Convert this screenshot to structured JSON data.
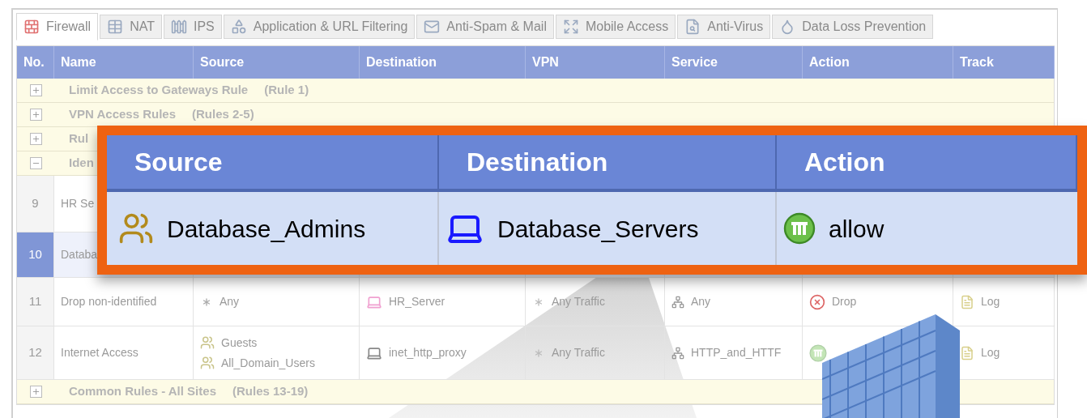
{
  "tabs": [
    {
      "label": "Firewall",
      "selected": true
    },
    {
      "label": "NAT",
      "selected": false
    },
    {
      "label": "IPS",
      "selected": false
    },
    {
      "label": "Application & URL Filtering",
      "selected": false
    },
    {
      "label": "Anti-Spam & Mail",
      "selected": false
    },
    {
      "label": "Mobile Access",
      "selected": false
    },
    {
      "label": "Anti-Virus",
      "selected": false
    },
    {
      "label": "Data Loss Prevention",
      "selected": false
    }
  ],
  "table": {
    "columns": [
      "No.",
      "Name",
      "Source",
      "Destination",
      "VPN",
      "Service",
      "Action",
      "Track"
    ],
    "rows": [
      {
        "kind": "group",
        "expanded": false,
        "title": "Limit Access to Gateways Rule",
        "range": "(Rule 1)"
      },
      {
        "kind": "group",
        "expanded": false,
        "title": "VPN Access Rules",
        "range": "(Rules 2-5)"
      },
      {
        "kind": "group",
        "expanded": false,
        "title": "Rul"
      },
      {
        "kind": "group",
        "expanded": true,
        "title": "Iden"
      },
      {
        "kind": "rule",
        "number": "9",
        "selected": false,
        "name": "HR Se"
      },
      {
        "kind": "rule",
        "number": "10",
        "selected": true,
        "name": "Databa"
      },
      {
        "kind": "rule",
        "number": "11",
        "selected": false,
        "name": "Drop non-identified",
        "source": [
          "Any"
        ],
        "destination": "HR_Server",
        "vpn": "Any Traffic",
        "service": "Any",
        "action": "Drop",
        "action_allowed": false,
        "track": "Log"
      },
      {
        "kind": "rule",
        "number": "12",
        "selected": false,
        "name": "Internet Access",
        "source": [
          "Guests",
          "All_Domain_Users"
        ],
        "destination": "inet_http_proxy",
        "vpn": "Any Traffic",
        "service": "HTTP_and_HTTF",
        "action_allowed": true,
        "track": "Log"
      },
      {
        "kind": "group",
        "expanded": false,
        "title": "Common Rules - All Sites",
        "range": "(Rules 13-19)"
      }
    ]
  },
  "callout": {
    "columns": [
      "Source",
      "Destination",
      "Action"
    ],
    "row": {
      "source": "Database_Admins",
      "destination": "Database_Servers",
      "action": "allow",
      "action_allowed": true
    }
  }
}
